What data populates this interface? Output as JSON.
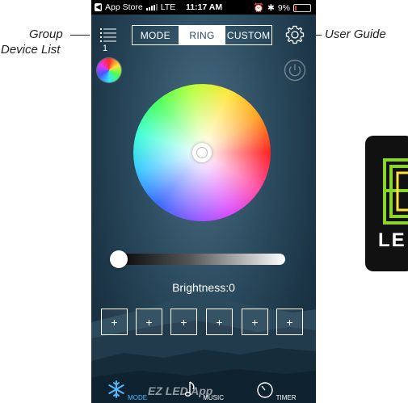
{
  "callouts": {
    "group_line1": "Group",
    "group_line2": "Device List",
    "user_guide": "User Guide"
  },
  "status_bar": {
    "back_app": "App Store",
    "network": "LTE",
    "time": "11:17 AM",
    "battery": "9%"
  },
  "header": {
    "group_count": "1",
    "tabs": [
      {
        "label": "MODE",
        "active": false
      },
      {
        "label": "RING",
        "active": true
      },
      {
        "label": "CUSTOM",
        "active": false
      }
    ]
  },
  "brightness": {
    "label": "Brightness:0",
    "value": 0
  },
  "presets": [
    "+",
    "+",
    "+",
    "+",
    "+",
    "+"
  ],
  "tabbar": {
    "items": [
      {
        "label": "MODE",
        "active": true
      },
      {
        "label": "MUSIC",
        "active": false
      },
      {
        "label": "TIMER",
        "active": false
      }
    ]
  },
  "watermark": "EZ LED App",
  "logo_text": "LE",
  "colors": {
    "active_tab": "#4fb8ff",
    "logo_green": "#8bd42a"
  }
}
